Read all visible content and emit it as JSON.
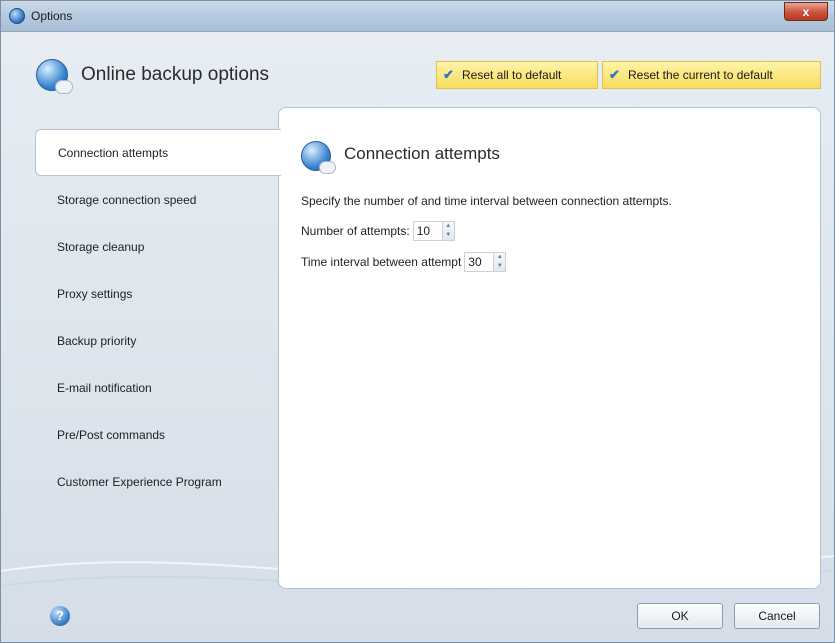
{
  "window": {
    "title": "Options",
    "close_label": "x"
  },
  "header": {
    "title": "Online backup options",
    "reset_all_label": "Reset all to default",
    "reset_current_label": "Reset the current to default"
  },
  "sidebar": {
    "items": [
      {
        "label": "Connection attempts",
        "active": true
      },
      {
        "label": "Storage connection speed"
      },
      {
        "label": "Storage cleanup"
      },
      {
        "label": "Proxy settings"
      },
      {
        "label": "Backup priority"
      },
      {
        "label": "E-mail notification"
      },
      {
        "label": "Pre/Post commands"
      },
      {
        "label": "Customer Experience Program"
      }
    ]
  },
  "panel": {
    "title": "Connection attempts",
    "description": "Specify the number of and time interval between connection attempts.",
    "attempts_label": "Number of attempts:",
    "attempts_value": "10",
    "interval_label": "Time interval between attempt",
    "interval_value": "30"
  },
  "footer": {
    "ok_label": "OK",
    "cancel_label": "Cancel",
    "help_glyph": "?"
  },
  "colors": {
    "reset_button_bg": "#f8dd5c",
    "accent_blue": "#2b78c9"
  }
}
